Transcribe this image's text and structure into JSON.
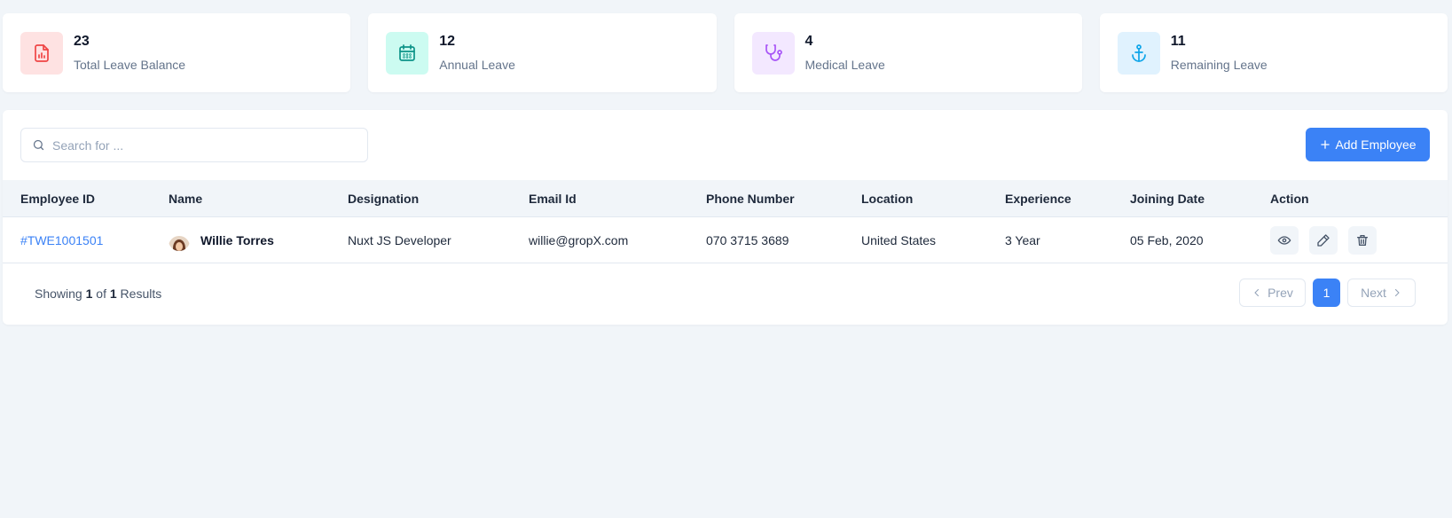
{
  "stats": [
    {
      "value": "23",
      "label": "Total Leave Balance",
      "icon": "file-chart-icon",
      "bg": "#fee2e2",
      "fg": "#ef4444"
    },
    {
      "value": "12",
      "label": "Annual Leave",
      "icon": "calendar-icon",
      "bg": "#ccfbf1",
      "fg": "#0d9488"
    },
    {
      "value": "4",
      "label": "Medical Leave",
      "icon": "stethoscope-icon",
      "bg": "#f3e8ff",
      "fg": "#a855f7"
    },
    {
      "value": "11",
      "label": "Remaining Leave",
      "icon": "anchor-icon",
      "bg": "#e0f2fe",
      "fg": "#0ea5e9"
    }
  ],
  "toolbar": {
    "search_placeholder": "Search for ...",
    "add_label": "Add Employee"
  },
  "table": {
    "columns": [
      "Employee ID",
      "Name",
      "Designation",
      "Email Id",
      "Phone Number",
      "Location",
      "Experience",
      "Joining Date",
      "Action"
    ],
    "rows": [
      {
        "id": "#TWE1001501",
        "name": "Willie Torres",
        "designation": "Nuxt JS Developer",
        "email": "willie@gropX.com",
        "phone": "070 3715 3689",
        "location": "United States",
        "experience": "3 Year",
        "joining": "05 Feb, 2020"
      }
    ]
  },
  "footer": {
    "showing_prefix": "Showing",
    "shown": "1",
    "of": "of",
    "total": "1",
    "suffix": "Results"
  },
  "pagination": {
    "prev": "Prev",
    "current": "1",
    "next": "Next"
  },
  "colors": {
    "accent": "#3b82f6",
    "background": "#f1f5f9"
  }
}
